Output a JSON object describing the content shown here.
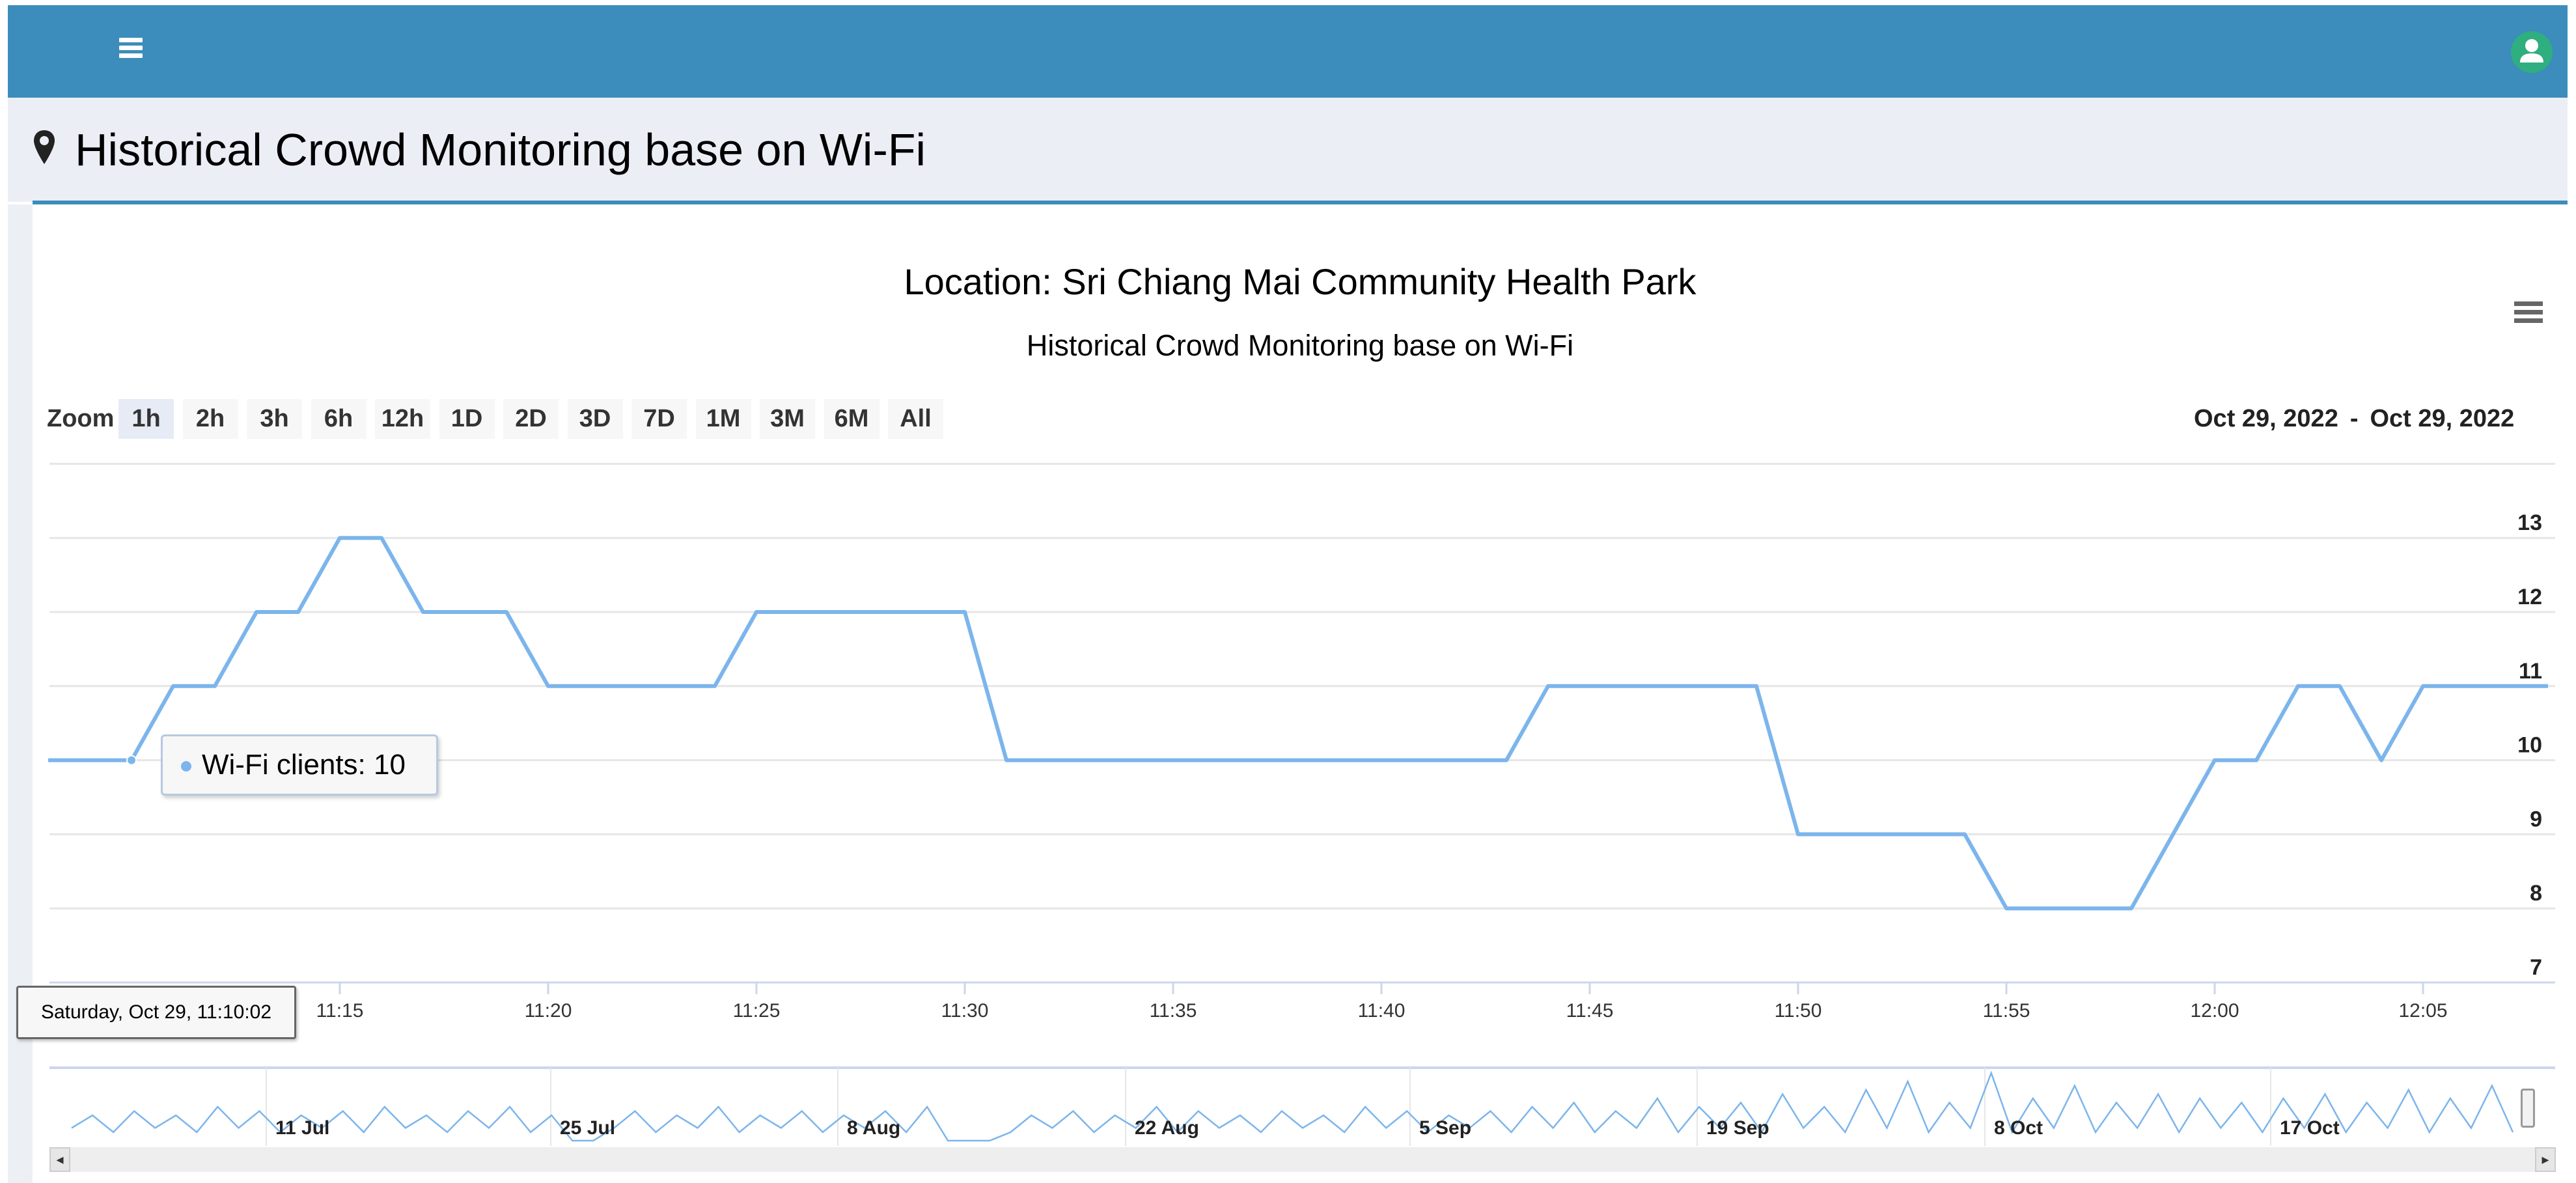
{
  "header": {
    "menu_icon": "hamburger-icon",
    "user_icon": "user-icon",
    "color": "#3c8cbc"
  },
  "page": {
    "title": "Historical Crowd Monitoring base on Wi-Fi",
    "title_icon": "map-marker-icon"
  },
  "chart": {
    "title": "Location: Sri Chiang Mai Community Health Park",
    "subtitle": "Historical Crowd Monitoring base on Wi-Fi",
    "menu_icon": "chart-menu-icon",
    "zoom_label": "Zoom",
    "zoom_buttons": [
      "1h",
      "2h",
      "3h",
      "6h",
      "12h",
      "1D",
      "2D",
      "3D",
      "7D",
      "1M",
      "3M",
      "6M",
      "All"
    ],
    "zoom_active": "1h",
    "date_from": "Oct 29, 2022",
    "date_sep": "-",
    "date_to": "Oct 29, 2022",
    "tooltip": {
      "label": "Wi-Fi clients: 10"
    },
    "crosshair_label": "Saturday, Oct 29, 11:10:02"
  },
  "chart_data": {
    "type": "line",
    "title": "Location: Sri Chiang Mai Community Health Park",
    "subtitle": "Historical Crowd Monitoring base on Wi-Fi",
    "series": [
      {
        "name": "Wi-Fi clients",
        "color": "#7cb5ec",
        "x": [
          "11:08",
          "11:10",
          "11:11",
          "11:12",
          "11:13",
          "11:14",
          "11:15",
          "11:16",
          "11:17",
          "11:19",
          "11:20",
          "11:24",
          "11:25",
          "11:30",
          "11:31",
          "11:43",
          "11:44",
          "11:49",
          "11:50",
          "11:54",
          "11:55",
          "11:58",
          "12:00",
          "12:01",
          "12:02",
          "12:03",
          "12:04",
          "12:05",
          "12:08"
        ],
        "values": [
          10,
          10,
          11,
          11,
          12,
          12,
          13,
          13,
          12,
          12,
          11,
          11,
          12,
          12,
          10,
          10,
          11,
          11,
          9,
          9,
          8,
          8,
          10,
          10,
          11,
          11,
          10,
          11,
          11
        ]
      }
    ],
    "xlim": [
      "11:08",
      "12:08"
    ],
    "ylim": [
      7,
      14
    ],
    "y_ticks": [
      "7",
      "8",
      "9",
      "10",
      "11",
      "12",
      "13"
    ],
    "x_ticks": [
      "11:15",
      "11:20",
      "11:25",
      "11:30",
      "11:35",
      "11:40",
      "11:45",
      "11:50",
      "11:55",
      "12:00",
      "12:05"
    ],
    "grid": true,
    "y_axis_side": "right",
    "navigator": {
      "labels": [
        "11 Jul",
        "25 Jul",
        "8 Aug",
        "22 Aug",
        "5 Sep",
        "19 Sep",
        "8 Oct",
        "17 Oct"
      ],
      "values": [
        3,
        6,
        2,
        7,
        3,
        6,
        2,
        8,
        3,
        7,
        2,
        6,
        3,
        7,
        2,
        8,
        3,
        6,
        2,
        7,
        3,
        8,
        2,
        6,
        0,
        0,
        3,
        7,
        2,
        6,
        3,
        8,
        2,
        6,
        3,
        7,
        2,
        6,
        3,
        7,
        2,
        8,
        0,
        0,
        0,
        2,
        6,
        3,
        7,
        2,
        6,
        3,
        8,
        2,
        7,
        3,
        6,
        2,
        7,
        3,
        6,
        2,
        8,
        3,
        7,
        2,
        6,
        3,
        7,
        2,
        8,
        3,
        9,
        2,
        7,
        3,
        10,
        2,
        8,
        3,
        9,
        2,
        11,
        3,
        8,
        2,
        12,
        3,
        14,
        2,
        9,
        3,
        16,
        2,
        10,
        3,
        13,
        2,
        9,
        3,
        11,
        2,
        10,
        3,
        9,
        2,
        10,
        3,
        11,
        2,
        9,
        3,
        12,
        2,
        10,
        3,
        13,
        2
      ]
    }
  }
}
